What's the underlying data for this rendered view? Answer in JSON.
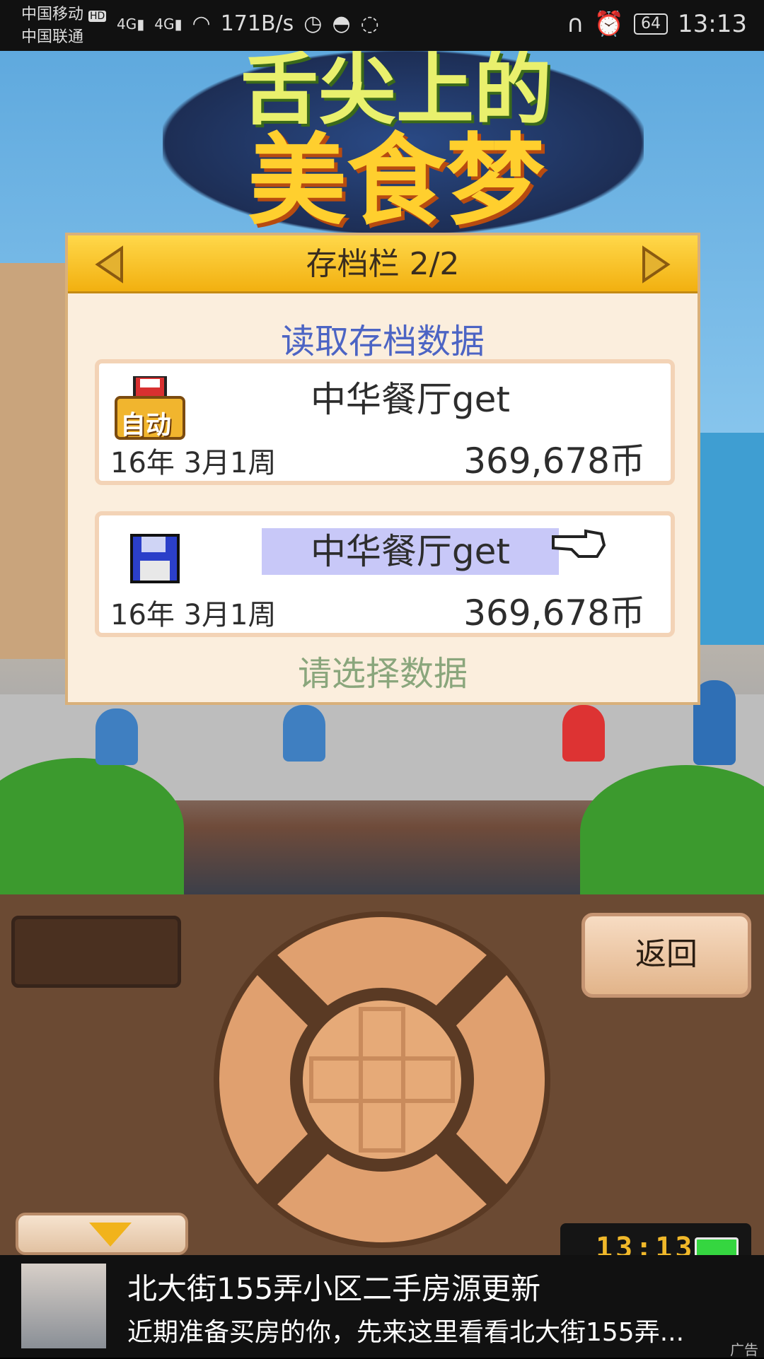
{
  "status_bar": {
    "carrier1": "中国移动",
    "carrier2": "中国联通",
    "hd_badge": "HD",
    "network1": "4G",
    "network2": "4G",
    "speed": "171B/s",
    "battery": "64",
    "time": "13:13"
  },
  "logo": {
    "line1": "舌尖上的",
    "line2": "美食梦"
  },
  "dialog": {
    "header_title": "存档栏 2/2",
    "subtitle": "读取存档数据",
    "slots": [
      {
        "badge": "自动",
        "name": "中华餐厅get",
        "date": "16年 3月1周",
        "coins": "369,678币"
      },
      {
        "badge": "",
        "name": "中华餐厅get",
        "date": "16年 3月1周",
        "coins": "369,678币"
      }
    ],
    "prompt": "请选择数据"
  },
  "controls": {
    "back_label": "返回",
    "clock": "13:13"
  },
  "ad": {
    "title": "北大街155弄小区二手房源更新",
    "desc": "近期准备买房的你，先来这里看看北大街155弄...",
    "label": "广告"
  },
  "colors": {
    "header_gold": "#f2b010",
    "subtitle_blue": "#4c64c4",
    "prompt_green": "#8aa67c",
    "selection": "#c8c8f8"
  }
}
